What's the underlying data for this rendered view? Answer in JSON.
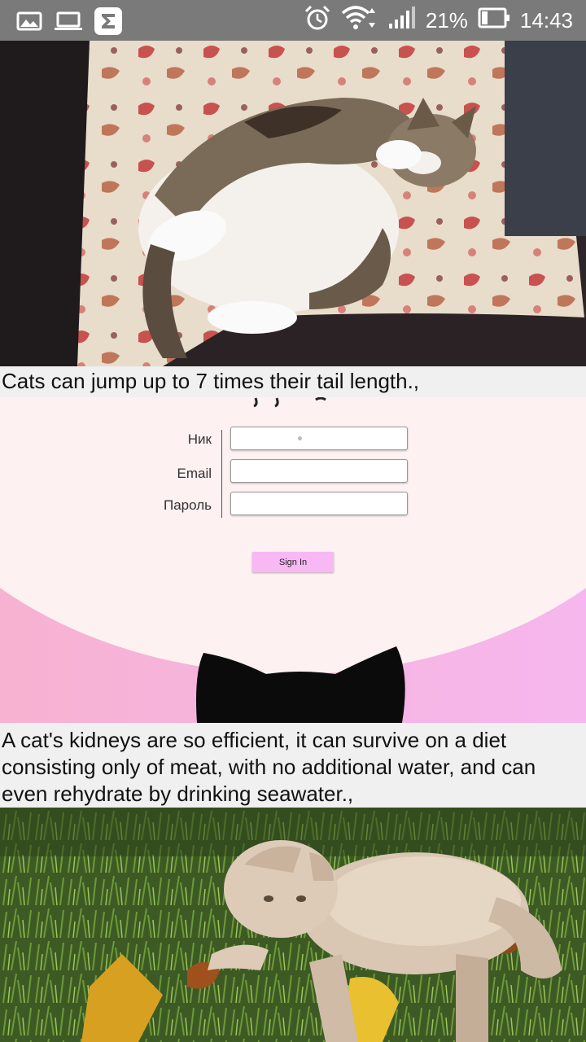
{
  "status_bar": {
    "left_icons": [
      "gallery-icon",
      "laptop-icon",
      "sigma-app-icon"
    ],
    "battery_percent": "21%",
    "time": "14:43",
    "right_icons": [
      "alarm-icon",
      "wifi-icon",
      "signal-icon",
      "battery-icon"
    ]
  },
  "feed": {
    "fact1": "Cats can jump up to 7 times their tail length.,",
    "fact2": "A cat's kidneys are so efficient, it can survive on a diet consisting only of meat, with no additional water, and can even rehydrate by drinking seawater.,"
  },
  "form": {
    "nick_label": "Ник",
    "email_label": "Email",
    "password_label": "Пароль",
    "sign_in_label": "Sign In"
  },
  "colors": {
    "status_bar_bg": "#7a7a7a",
    "panel_bg": "#fdf1f2",
    "pink_gradient_start": "#f7b2d1",
    "pink_gradient_end": "#f6b7ee",
    "button_bg": "#f8b8f4"
  }
}
